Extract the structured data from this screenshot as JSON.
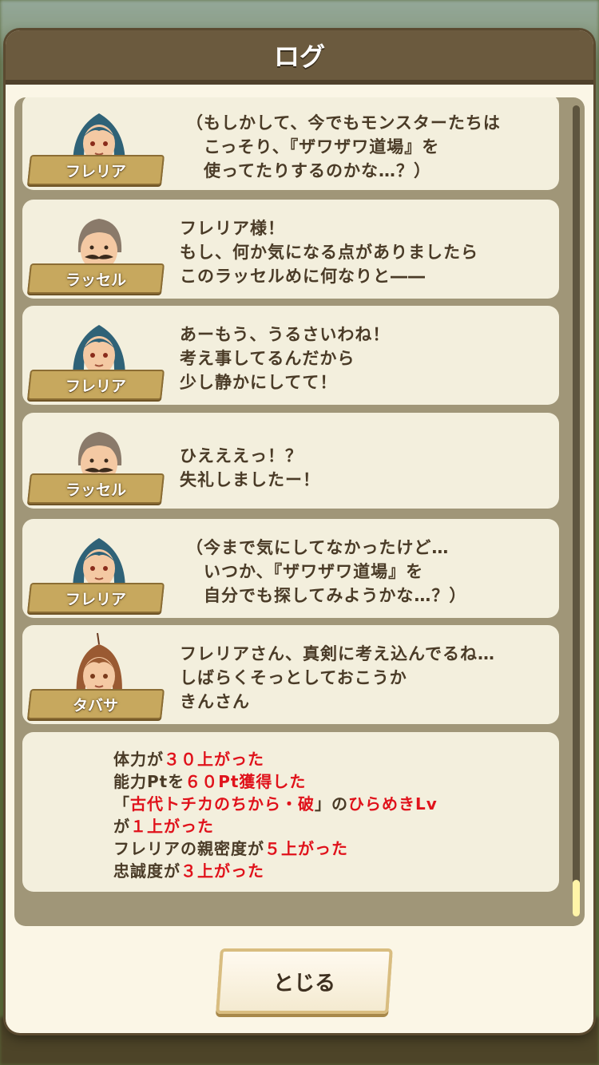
{
  "modal": {
    "title": "ログ"
  },
  "entries": [
    {
      "speaker": "フレリア",
      "portrait": "frelia",
      "lines": [
        "（もしかして、今でもモンスターたちは",
        "　こっそり、『ザワザワ道場』を",
        "　使ってたりするのかな…？）"
      ]
    },
    {
      "speaker": "ラッセル",
      "portrait": "russell",
      "lines": [
        "フレリア様！",
        "もし、何か気になる点がありましたら",
        "このラッセルめに何なりと――"
      ]
    },
    {
      "speaker": "フレリア",
      "portrait": "frelia",
      "lines": [
        "あーもう、うるさいわね！",
        "考え事してるんだから",
        "少し静かにしてて！"
      ]
    },
    {
      "speaker": "ラッセル",
      "portrait": "russell",
      "lines": [
        "ひえええっ！？",
        "失礼しましたー！"
      ]
    },
    {
      "speaker": "フレリア",
      "portrait": "frelia",
      "lines": [
        "（今まで気にしてなかったけど…",
        "　いつか、『ザワザワ道場』を",
        "　自分でも探してみようかな…？）"
      ]
    },
    {
      "speaker": "タバサ",
      "portrait": "tabasa",
      "lines": [
        "フレリアさん、真剣に考え込んでるね…",
        "しばらくそっとしておこうか",
        "きんさん"
      ]
    }
  ],
  "results": [
    [
      {
        "t": "体力が"
      },
      {
        "t": "３０上がった",
        "hl": true
      }
    ],
    [
      {
        "t": "能力Ptを"
      },
      {
        "t": "６０Pt獲得した",
        "hl": true
      }
    ],
    [
      {
        "t": "「"
      },
      {
        "t": "古代トチカのちから・破",
        "hl": true
      },
      {
        "t": "」の"
      },
      {
        "t": "ひらめきLv",
        "hl": true
      }
    ],
    [
      {
        "t": "が"
      },
      {
        "t": "１上がった",
        "hl": true
      }
    ],
    [
      {
        "t": "フレリアの親密度が"
      },
      {
        "t": "５上がった",
        "hl": true
      }
    ],
    [
      {
        "t": "忠誠度が"
      },
      {
        "t": "３上がった",
        "hl": true
      }
    ]
  ],
  "close_button": {
    "label": "とじる"
  },
  "colors": {
    "highlight": "#e0121b",
    "text": "#4a3b27",
    "header": "#6b5a3e"
  }
}
